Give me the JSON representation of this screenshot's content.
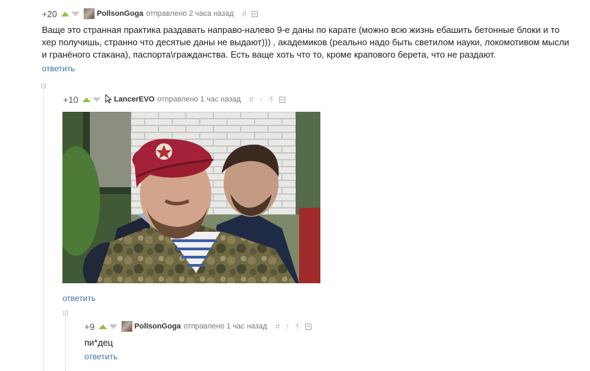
{
  "comments": [
    {
      "rating": "+20",
      "author": "PollsonGoga",
      "posted": "отправлено 2 часа назад",
      "lines": [
        "Ваще это странная практика раздавать направо-налево 9-е даны по карате (можно всю жизнь ебашить бетонные блоки и то",
        "хер получишь, странно что десятые даны не выдают))) , академиков (реально надо быть светилом науки, локомотивом мысли",
        "и гранёного стакана), паспорта\\гражданства. Есть ваще хоть что то, кроме крапового берета, что не раздают."
      ],
      "reply": "ответить",
      "hash": "#"
    },
    {
      "rating": "+10",
      "author": "LancerEVO",
      "posted": "отправлено 1 час назад",
      "reply": "ответить",
      "hash": "#",
      "up_arrow": "↑",
      "branch": "ᛡ",
      "image_alt": "man in maroon beret and camouflage uniform"
    },
    {
      "rating": "+9",
      "author": "PollsonGoga",
      "posted": "отправлено 1 час назад",
      "text": "пи*дец",
      "reply": "ответить",
      "hash": "#",
      "up_arrow": "↑",
      "branch": "ᛡ"
    }
  ],
  "icons": {
    "vote_up": "triangle-up-icon",
    "vote_down": "triangle-down-icon",
    "save": "save-icon",
    "cursor": "cursor-icon"
  },
  "colors": {
    "reply_link": "#3b72a6",
    "vote_up": "#8bc34a",
    "vote_down": "#c8c8c8"
  }
}
